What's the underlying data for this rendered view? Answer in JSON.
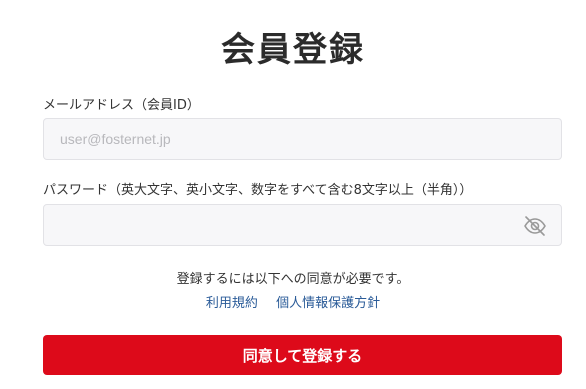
{
  "page": {
    "title": "会員登録"
  },
  "form": {
    "email": {
      "label": "メールアドレス（会員ID）",
      "placeholder": "user@fosternet.jp",
      "value": ""
    },
    "password": {
      "label": "パスワード（英大文字、英小文字、数字をすべて含む8文字以上（半角））",
      "placeholder": "",
      "value": "",
      "toggle_icon": "eye-slash-icon"
    },
    "consent_note": "登録するには以下への同意が必要です。",
    "links": [
      {
        "label": "利用規約"
      },
      {
        "label": "個人情報保護方針"
      }
    ],
    "submit_label": "同意して登録する"
  },
  "colors": {
    "accent": "#dd0a1a",
    "link": "#2a5b98",
    "field_bg": "#f7f7f9"
  }
}
